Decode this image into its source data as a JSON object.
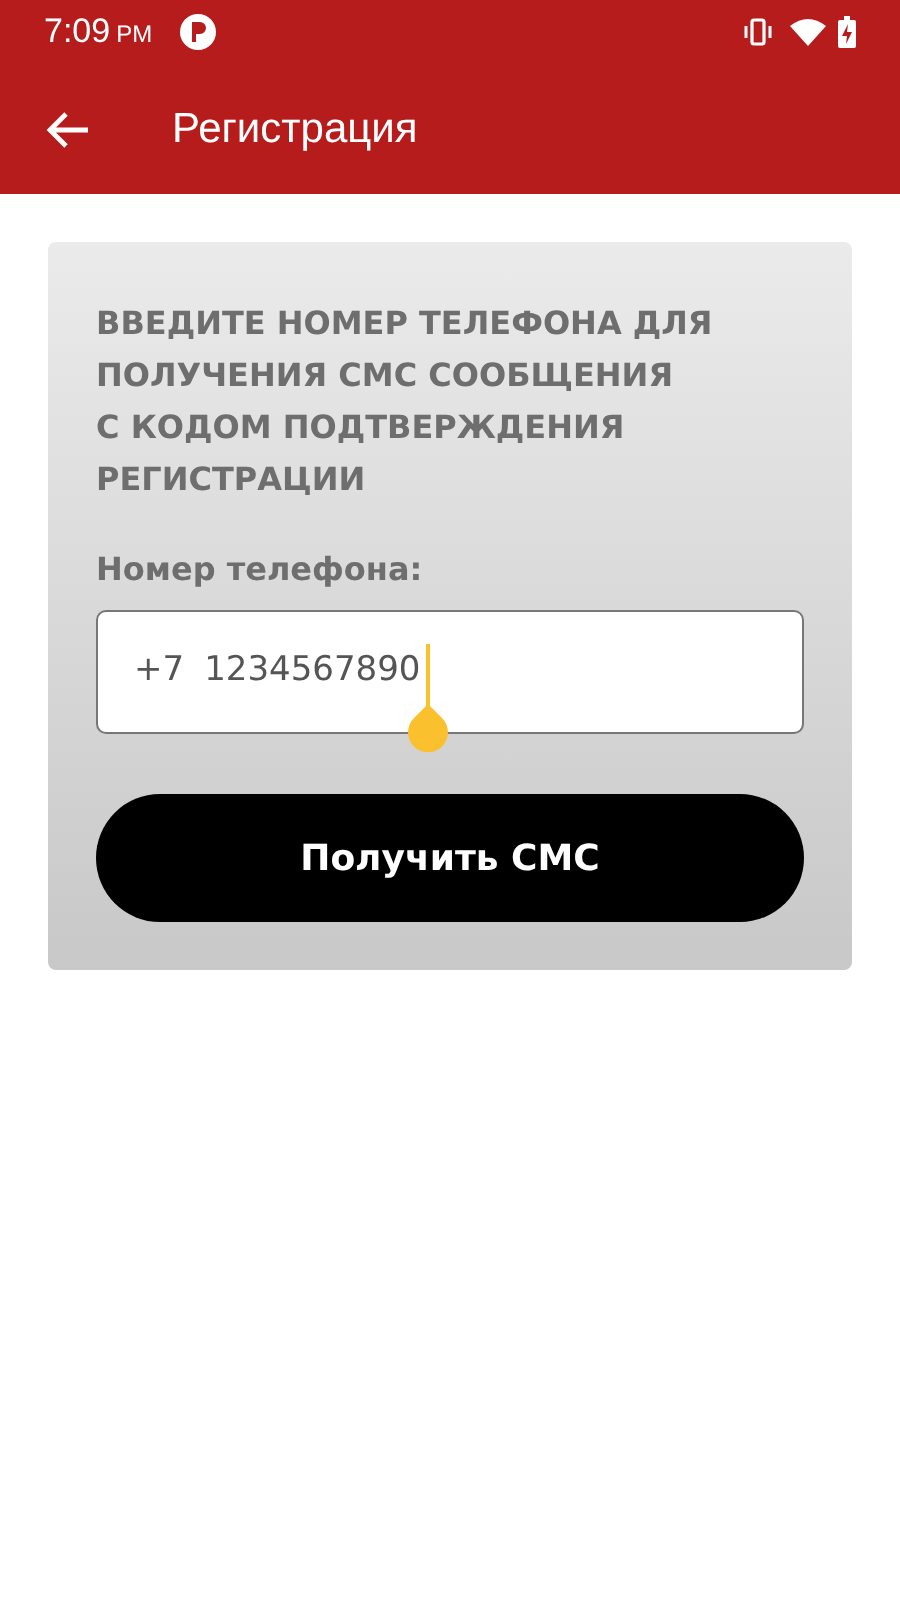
{
  "status_bar": {
    "time": "7:09",
    "ampm": "PM"
  },
  "app_bar": {
    "title": "Регистрация"
  },
  "card": {
    "instruction": "ВВЕДИТЕ НОМЕР ТЕЛЕФОНА ДЛЯ\nПОЛУЧЕНИЯ СМС СООБЩЕНИЯ\nС КОДОМ ПОДТВЕРЖДЕНИЯ\nРЕГИСТРАЦИИ",
    "phone_label": "Номер телефона:",
    "phone_prefix": "+7",
    "phone_value": "1234567890",
    "focused": true,
    "button": "Получить СМС"
  }
}
